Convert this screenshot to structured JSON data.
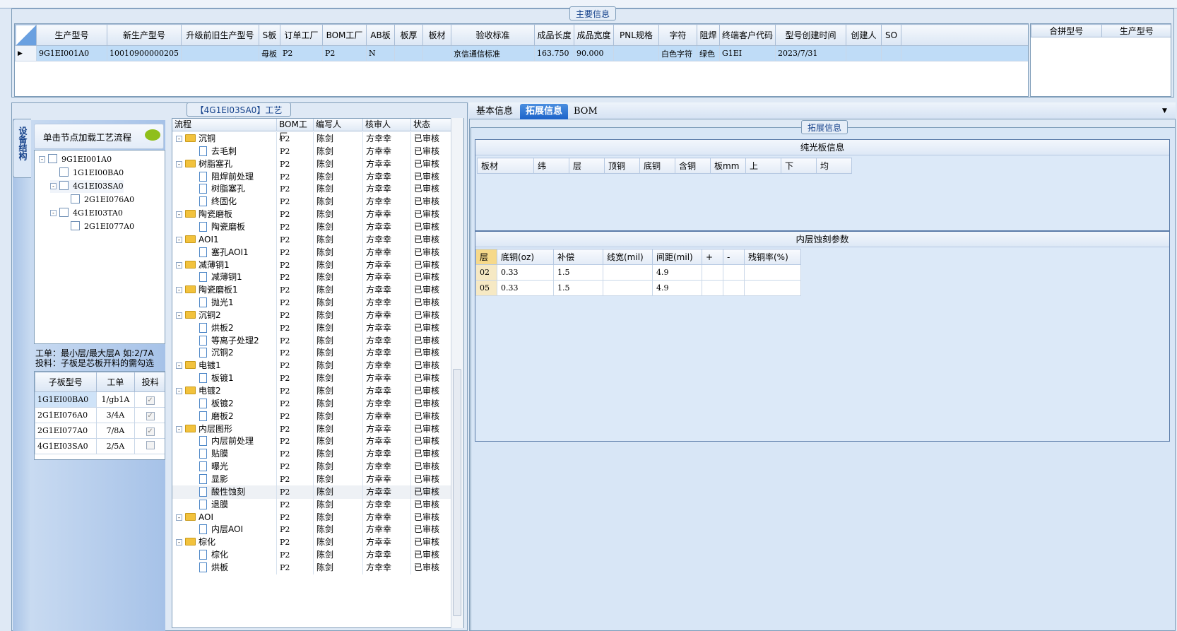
{
  "main_group_title": "主要信息",
  "main_columns": [
    "生产型号",
    "新生产型号",
    "升级前旧生产型号",
    "S板",
    "订单工厂",
    "BOM工厂",
    "AB板",
    "板厚",
    "板材",
    "验收标准",
    "成品长度",
    "成品宽度",
    "PNL规格",
    "字符",
    "阻焊",
    "终端客户代码",
    "型号创建时间",
    "创建人",
    "SO"
  ],
  "main_row": [
    "9G1EI001A0",
    "10010900000205",
    "",
    "母板",
    "P2",
    "P2",
    "N",
    "",
    "",
    "京信通信标准",
    "163.750",
    "90.000",
    "",
    "白色字符",
    "绿色",
    "G1EI",
    "2023/7/31",
    "",
    ""
  ],
  "right_columns": [
    "合拼型号",
    "生产型号"
  ],
  "side_tab": "设备结构",
  "load_hint": "单击节点加载工艺流程",
  "left_tree": [
    {
      "label": "9G1EI001A0",
      "level": 0,
      "exp": "-"
    },
    {
      "label": "1G1EI00BA0",
      "level": 1,
      "exp": ""
    },
    {
      "label": "4G1EI03SA0",
      "level": 1,
      "exp": "-"
    },
    {
      "label": "2G1EI076A0",
      "level": 2,
      "exp": ""
    },
    {
      "label": "4G1EI03TA0",
      "level": 1,
      "exp": "-"
    },
    {
      "label": "2G1EI077A0",
      "level": 2,
      "exp": ""
    }
  ],
  "notes": [
    "工单：最小层/最大层A 如:2/7A",
    "投料：子板是芯板开料的需勾选"
  ],
  "sub_columns": [
    "子板型号",
    "工单",
    "投料"
  ],
  "sub_rows": [
    {
      "model": "1G1EI00BA0",
      "order": "1/gb1A",
      "checked": true
    },
    {
      "model": "2G1EI076A0",
      "order": "3/4A",
      "checked": true
    },
    {
      "model": "2G1EI077A0",
      "order": "7/8A",
      "checked": true
    },
    {
      "model": "4G1EI03SA0",
      "order": "2/5A",
      "checked": false
    }
  ],
  "process_title": "【4G1EI03SA0】工艺流程",
  "process_columns": [
    "流程",
    "BOM工厂",
    "编写人",
    "核审人",
    "状态"
  ],
  "process_rows": [
    {
      "name": "沉铜",
      "type": "folder"
    },
    {
      "name": "去毛刺",
      "type": "doc"
    },
    {
      "name": "树脂塞孔",
      "type": "folder"
    },
    {
      "name": "阻焊前处理",
      "type": "doc"
    },
    {
      "name": "树脂塞孔",
      "type": "doc"
    },
    {
      "name": "终固化",
      "type": "doc"
    },
    {
      "name": "陶瓷磨板",
      "type": "folder"
    },
    {
      "name": "陶瓷磨板",
      "type": "doc"
    },
    {
      "name": "AOI1",
      "type": "folder"
    },
    {
      "name": "塞孔AOI1",
      "type": "doc"
    },
    {
      "name": "减薄铜1",
      "type": "folder"
    },
    {
      "name": "减薄铜1",
      "type": "doc"
    },
    {
      "name": "陶瓷磨板1",
      "type": "folder"
    },
    {
      "name": "抛光1",
      "type": "doc"
    },
    {
      "name": "沉铜2",
      "type": "folder"
    },
    {
      "name": "烘板2",
      "type": "doc"
    },
    {
      "name": "等离子处理2",
      "type": "doc"
    },
    {
      "name": "沉铜2",
      "type": "doc"
    },
    {
      "name": "电镀1",
      "type": "folder"
    },
    {
      "name": "板镀1",
      "type": "doc"
    },
    {
      "name": "电镀2",
      "type": "folder"
    },
    {
      "name": "板镀2",
      "type": "doc"
    },
    {
      "name": "磨板2",
      "type": "doc"
    },
    {
      "name": "内层图形",
      "type": "folder"
    },
    {
      "name": "内层前处理",
      "type": "doc"
    },
    {
      "name": "贴膜",
      "type": "doc"
    },
    {
      "name": "曝光",
      "type": "doc"
    },
    {
      "name": "显影",
      "type": "doc"
    },
    {
      "name": "酸性蚀刻",
      "type": "doc"
    },
    {
      "name": "退膜",
      "type": "doc"
    },
    {
      "name": "AOI",
      "type": "folder"
    },
    {
      "name": "内层AOI",
      "type": "doc"
    },
    {
      "name": "棕化",
      "type": "folder"
    },
    {
      "name": "棕化",
      "type": "doc"
    },
    {
      "name": "烘板",
      "type": "doc"
    }
  ],
  "process_bom": "P2",
  "process_writer": "陈剑",
  "process_reviewer": "方幸幸",
  "process_status": "已审核",
  "tabs": [
    "基本信息",
    "拓展信息",
    "BOM"
  ],
  "active_tab": "拓展信息",
  "ext_group_title": "拓展信息",
  "pure_title": "纯光板信息",
  "pure_columns": [
    "板材",
    "纬",
    "层",
    "顶铜",
    "底铜",
    "含铜",
    "板mm",
    "上",
    "下",
    "均"
  ],
  "etch_title": "内层蚀刻参数",
  "etch_columns": [
    "层",
    "底铜(oz)",
    "补偿",
    "线宽(mil)",
    "间距(mil)",
    "+",
    "-",
    "残铜率(%)"
  ],
  "etch_rows": [
    [
      "02",
      "0.33",
      "1.5",
      "",
      "4.9",
      "",
      "",
      ""
    ],
    [
      "05",
      "0.33",
      "1.5",
      "",
      "4.9",
      "",
      "",
      ""
    ]
  ]
}
